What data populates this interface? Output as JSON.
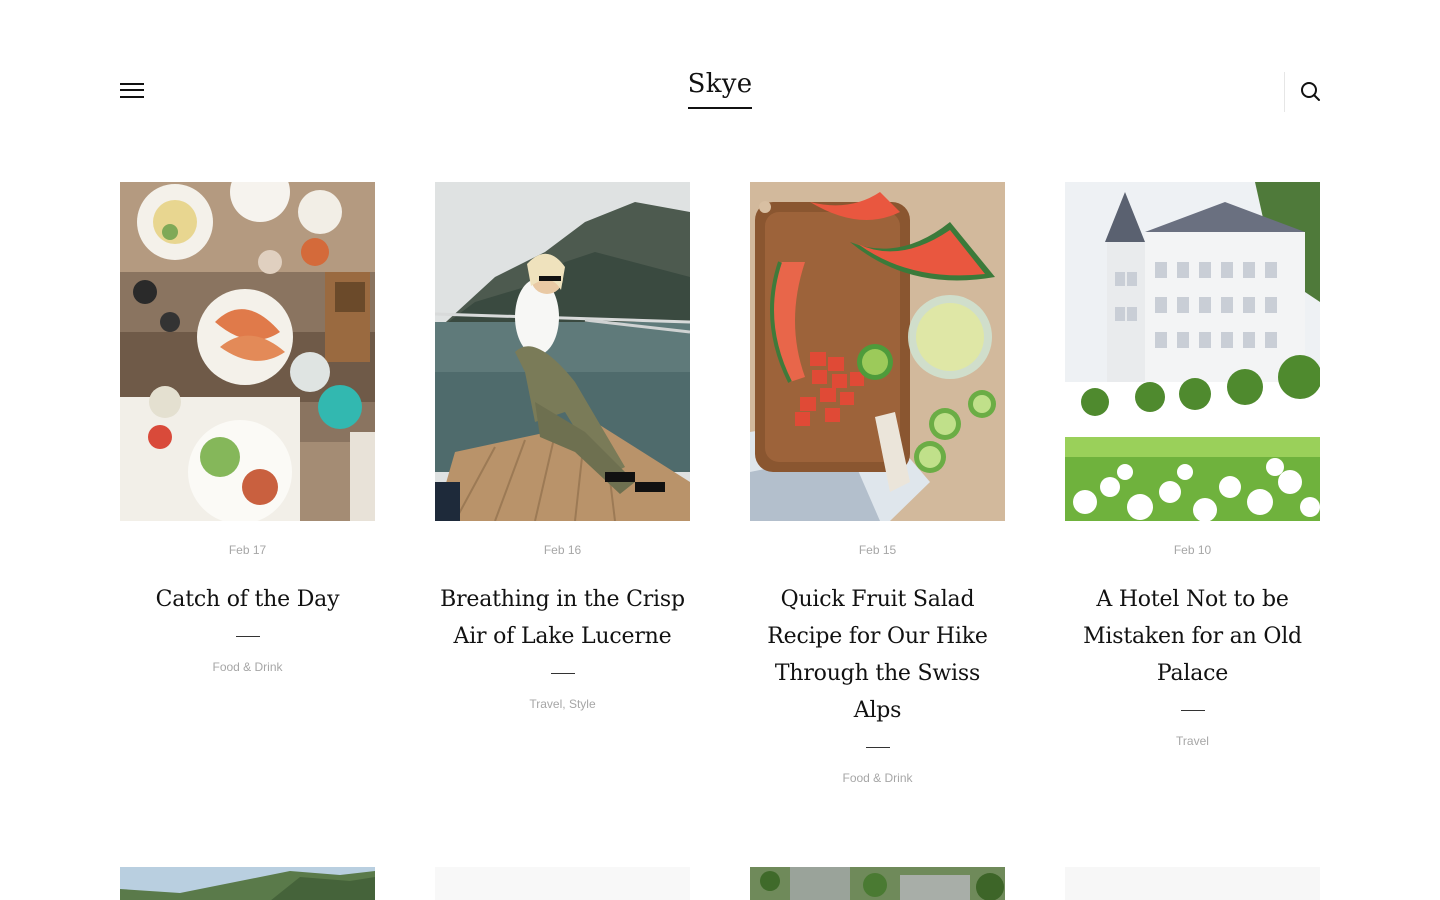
{
  "site": {
    "logo": "Skye"
  },
  "header": {
    "menu_icon": "hamburger-menu-icon",
    "search_icon": "search-icon"
  },
  "posts": [
    {
      "date": "Feb 17",
      "title": "Catch of the Day",
      "categories": "Food & Drink",
      "image": "food-table-image"
    },
    {
      "date": "Feb 16",
      "title": "Breathing in the Crisp Air of Lake Lucerne",
      "categories": "Travel, Style",
      "image": "boat-lake-image"
    },
    {
      "date": "Feb 15",
      "title": "Quick Fruit Salad Recipe for Our Hike Through the Swiss Alps",
      "categories": "Food & Drink",
      "image": "fruit-board-image"
    },
    {
      "date": "Feb 10",
      "title": "A Hotel Not to be Mistaken for an Old Palace",
      "categories": "Travel",
      "image": "hotel-palace-image"
    }
  ],
  "colors": {
    "text": "#111111",
    "meta": "#a6a6a6",
    "background": "#ffffff"
  }
}
